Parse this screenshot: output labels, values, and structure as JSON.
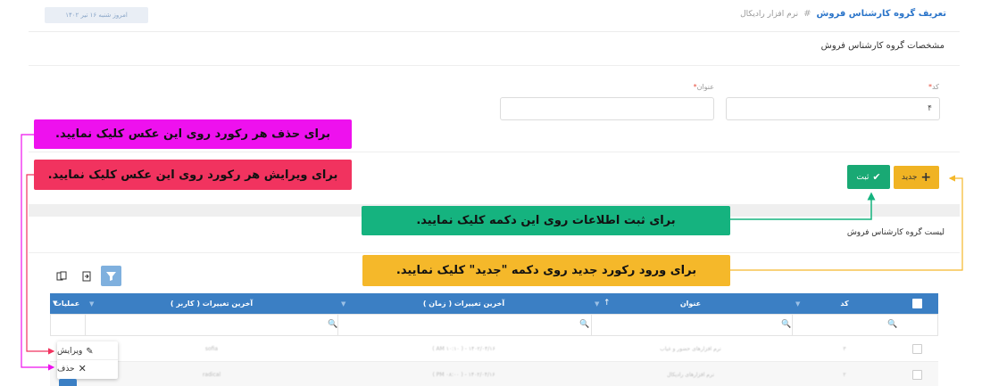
{
  "header": {
    "date_chip": "امروز شنبه ۱۶ تیر ۱۴۰۲",
    "title": "تعریف گروه کارشناس فروش",
    "separator": "#",
    "subtitle": "نرم افزار رادیکال"
  },
  "section": {
    "title": "مشخصات گروه کارشناس فروش"
  },
  "form": {
    "code_label": "کد",
    "code_value": "۴",
    "title_label": "عنوان",
    "required_mark": "*"
  },
  "toolbar": {
    "new_label": "جدید",
    "save_label": "ثبت"
  },
  "list": {
    "title": "لیست گروه کارشناس فروش"
  },
  "grid": {
    "columns": {
      "code": "کد",
      "title": "عنوان",
      "sort_arrow": "↑",
      "last_modified_time": "آخرین تغییرات ( زمان )",
      "last_modified_user": "آخرین تغییرات ( کاربر )",
      "operations": "عملیات"
    },
    "rows": [
      {
        "code": "۳",
        "title": "نرم افزارهای حضور و غیاب",
        "time": "۱۴۰۲/۰۴/۱۶ - ( ۱۰:۱۰ AM )",
        "user": "sofia"
      },
      {
        "code": "۲",
        "title": "نرم افزارهای رادیکال",
        "time": "۱۴۰۲/۰۴/۱۶ - ( ۰۸:۰۰ PM )",
        "user": "radical"
      }
    ]
  },
  "context_menu": {
    "edit_label": "ویرایش",
    "delete_label": "حذف"
  },
  "callouts": {
    "delete": "برای حذف هر رکورد روی این عکس کلیک نمایید.",
    "edit": "برای ویرایش هر رکورد روی این عکس کلیک نمایید.",
    "save": "برای ثبت اطلاعات روی این دکمه کلیک نمایید.",
    "new": "برای ورود رکورد جدید روی دکمه \"جدید\" کلیک نمایید."
  },
  "colors": {
    "brand_blue": "#3b7fc4",
    "save_green": "#19a974",
    "new_yellow": "#f0b323",
    "callout_magenta": "#ee11ee",
    "callout_pink": "#f1335f",
    "callout_green": "#15b37f",
    "callout_orange": "#f5b82a"
  }
}
